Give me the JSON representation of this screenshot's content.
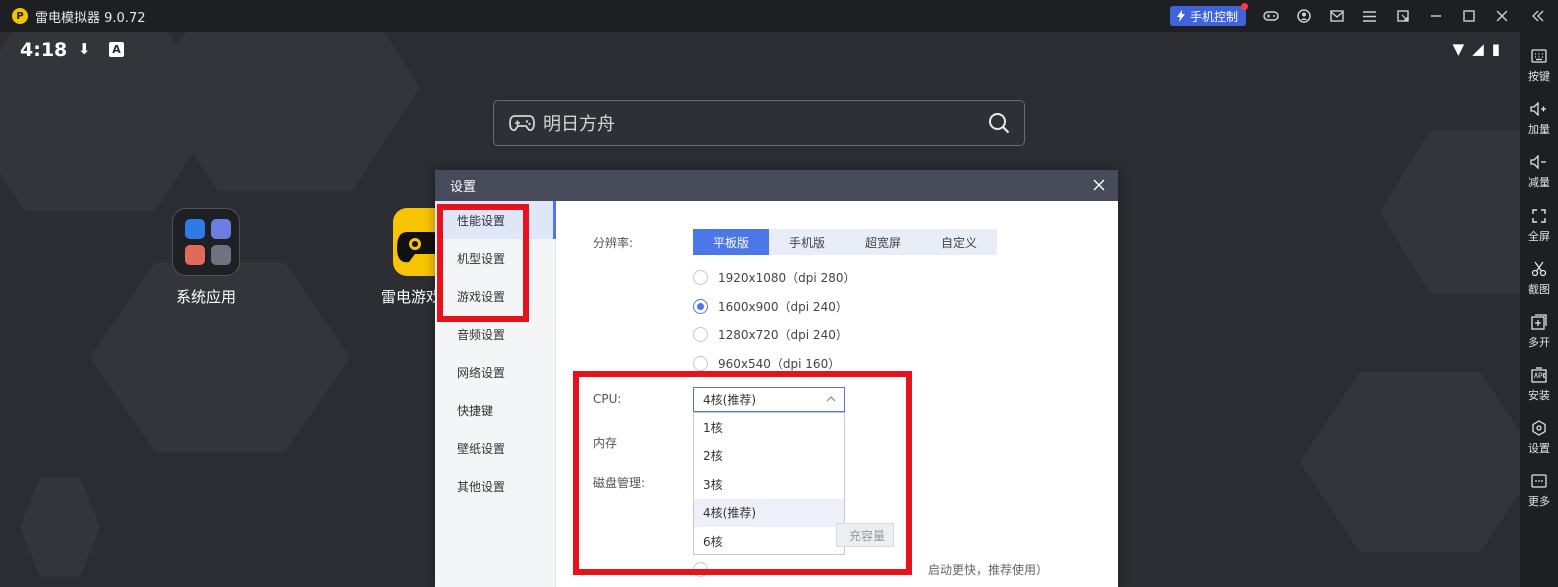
{
  "titlebar": {
    "app_title": "雷电模拟器 9.0.72",
    "logo_letter": "P",
    "phone_control_label": "手机控制",
    "icons": [
      "gamepad-icon",
      "user-icon",
      "mail-icon",
      "menu-icon",
      "restore-icon",
      "minimize-icon",
      "maximize-icon",
      "close-icon",
      "collapse-icon"
    ]
  },
  "statusbar": {
    "time": "4:18",
    "download_glyph": "⬇",
    "font_glyph": "A",
    "wifi_glyph": "▼",
    "signal_glyph": "◢",
    "battery_glyph": "▮"
  },
  "search": {
    "text": "明日方舟"
  },
  "desktop": {
    "apps": [
      {
        "label": "系统应用"
      },
      {
        "label": "雷电游戏中心"
      }
    ]
  },
  "rightbar": {
    "items": [
      {
        "label": "按键",
        "icon": "keyboard-icon"
      },
      {
        "label": "加量",
        "icon": "volume-up-icon"
      },
      {
        "label": "减量",
        "icon": "volume-down-icon"
      },
      {
        "label": "全屏",
        "icon": "fullscreen-icon"
      },
      {
        "label": "截图",
        "icon": "scissors-icon"
      },
      {
        "label": "多开",
        "icon": "multi-instance-icon"
      },
      {
        "label": "安装",
        "icon": "apk-install-icon"
      },
      {
        "label": "设置",
        "icon": "settings-icon"
      },
      {
        "label": "更多",
        "icon": "more-icon"
      }
    ]
  },
  "dialog": {
    "title": "设置",
    "nav": [
      {
        "label": "性能设置",
        "active": true
      },
      {
        "label": "机型设置"
      },
      {
        "label": "游戏设置"
      },
      {
        "label": "音频设置"
      },
      {
        "label": "网络设置"
      },
      {
        "label": "快捷键"
      },
      {
        "label": "壁纸设置"
      },
      {
        "label": "其他设置"
      }
    ],
    "resolution": {
      "label": "分辨率:",
      "tabs": [
        "平板版",
        "手机版",
        "超宽屏",
        "自定义"
      ],
      "active_tab": "平板版",
      "options": [
        "1920x1080（dpi 280）",
        "1600x900（dpi 240）",
        "1280x720（dpi 240）",
        "960x540（dpi 160）"
      ],
      "selected": "1600x900（dpi 240）"
    },
    "cpu": {
      "label": "CPU:",
      "value": "4核(推荐)",
      "options": [
        "1核",
        "2核",
        "3核",
        "4核(推荐)",
        "6核"
      ],
      "highlighted": "4核(推荐)"
    },
    "memory_label": "内存",
    "disk_label": "磁盘管理:",
    "partial_button": "充容量",
    "partial_row_text": "启动更快，推荐使用）"
  },
  "colors": {
    "accent": "#4b78e6",
    "highlight_red": "#e6131c",
    "titlebar_bg": "#1e1f23",
    "dialog_header": "#474a59"
  }
}
